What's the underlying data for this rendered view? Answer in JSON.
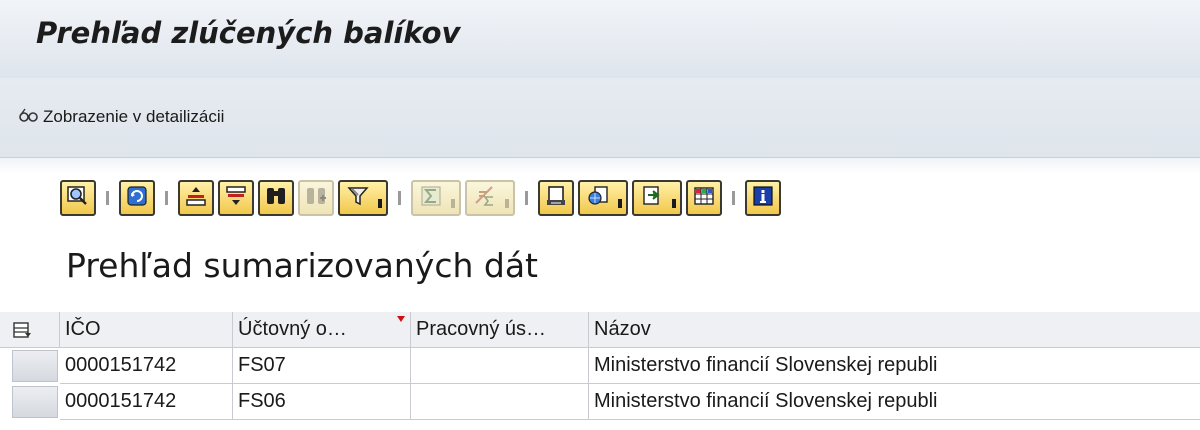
{
  "window": {
    "title": "Prehľad zlúčených balíkov"
  },
  "app_toolbar": {
    "detail_button_label": "Zobrazenie v detailizácii",
    "detail_icon": "glasses-icon"
  },
  "alv_toolbar": {
    "buttons": [
      {
        "icon": "search-details-icon",
        "enabled": true
      },
      {
        "icon": "refresh-icon",
        "enabled": true
      },
      {
        "icon": "sort-ascending-icon",
        "enabled": true
      },
      {
        "icon": "sort-descending-icon",
        "enabled": true
      },
      {
        "icon": "find-icon",
        "enabled": true
      },
      {
        "icon": "find-next-icon",
        "enabled": false
      },
      {
        "icon": "filter-icon",
        "enabled": true,
        "dropdown": true
      },
      {
        "icon": "total-icon",
        "enabled": false,
        "dropdown": true
      },
      {
        "icon": "subtotal-icon",
        "enabled": false,
        "dropdown": true
      },
      {
        "icon": "print-preview-icon",
        "enabled": true
      },
      {
        "icon": "views-icon",
        "enabled": true,
        "dropdown": true
      },
      {
        "icon": "export-icon",
        "enabled": true,
        "dropdown": true
      },
      {
        "icon": "layout-icon",
        "enabled": true
      },
      {
        "icon": "info-icon",
        "enabled": true
      }
    ]
  },
  "report": {
    "title": "Prehľad sumarizovaných dát"
  },
  "table": {
    "columns": [
      "IČO",
      "Účtovný o…",
      "Pracovný ús…",
      "Názov"
    ],
    "rows": [
      [
        "0000151742",
        "FS07",
        "",
        "Ministerstvo financií Slovenskej republi"
      ],
      [
        "0000151742",
        "FS06",
        "",
        "Ministerstvo financií Slovenskej republi"
      ]
    ]
  }
}
